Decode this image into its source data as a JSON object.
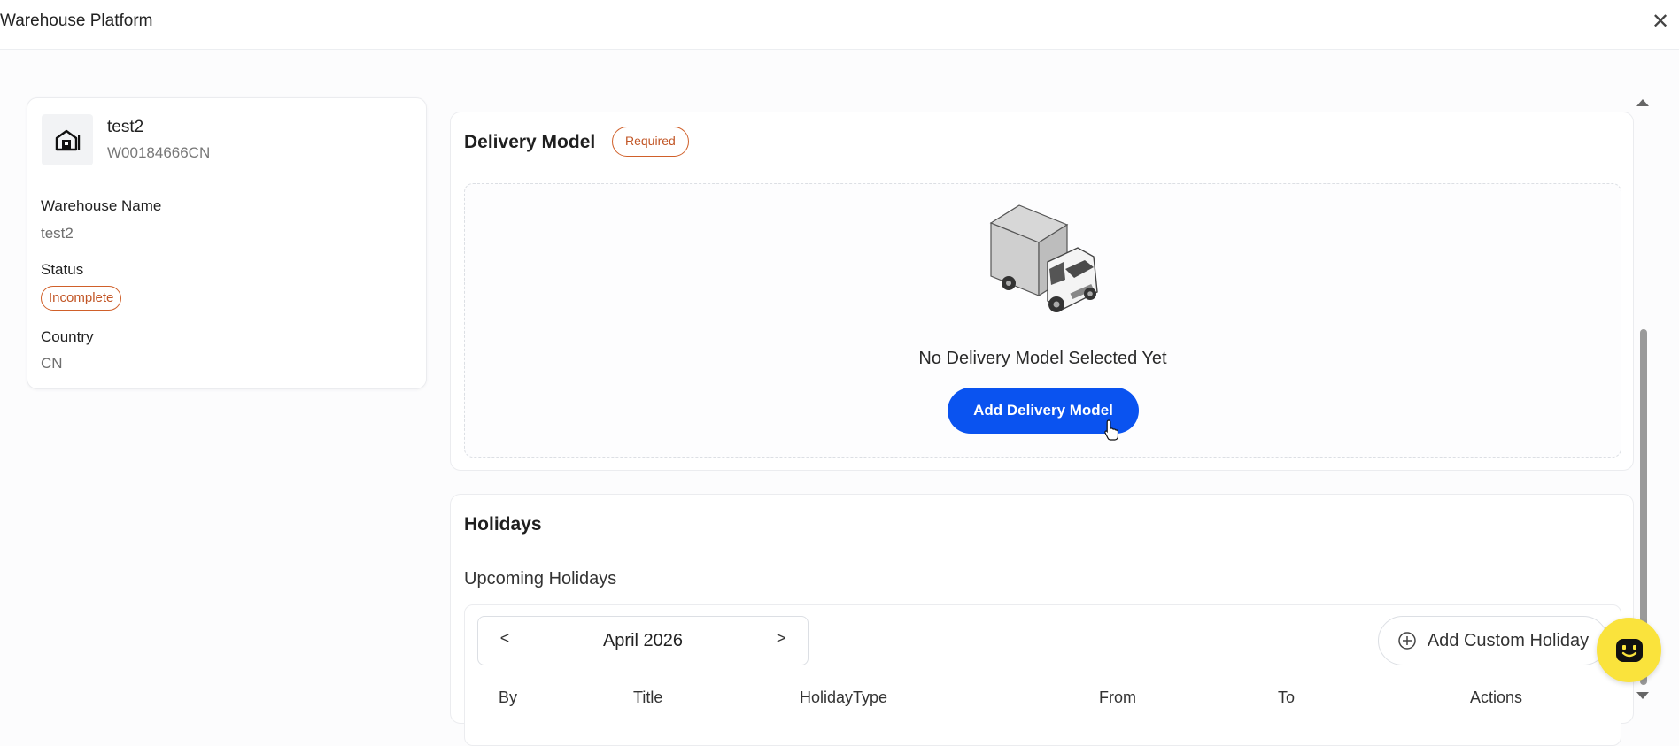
{
  "app": {
    "title": "Warehouse Platform",
    "close_glyph": "✕"
  },
  "warehouse": {
    "name": "test2",
    "code": "W00184666CN",
    "fields": {
      "name_label": "Warehouse Name",
      "name_value": "test2",
      "status_label": "Status",
      "status_value": "Incomplete",
      "country_label": "Country",
      "country_value": "CN"
    }
  },
  "delivery": {
    "title": "Delivery Model",
    "required_badge": "Required",
    "empty_text": "No Delivery Model Selected Yet",
    "add_button": "Add Delivery Model"
  },
  "holidays": {
    "title": "Holidays",
    "subtitle": "Upcoming Holidays",
    "month": "April 2026",
    "prev": "<",
    "next": ">",
    "add_button": "Add Custom Holiday",
    "columns": [
      "By",
      "Title",
      "HolidayType",
      "From",
      "To",
      "Actions"
    ]
  },
  "colors": {
    "accent": "#0a53f0",
    "warning": "#d0602a",
    "fab": "#fae33c"
  },
  "icons": [
    "close-icon",
    "warehouse-icon",
    "truck-illustration",
    "pointer-cursor-icon",
    "plus-circle-icon",
    "help-bot-icon"
  ]
}
